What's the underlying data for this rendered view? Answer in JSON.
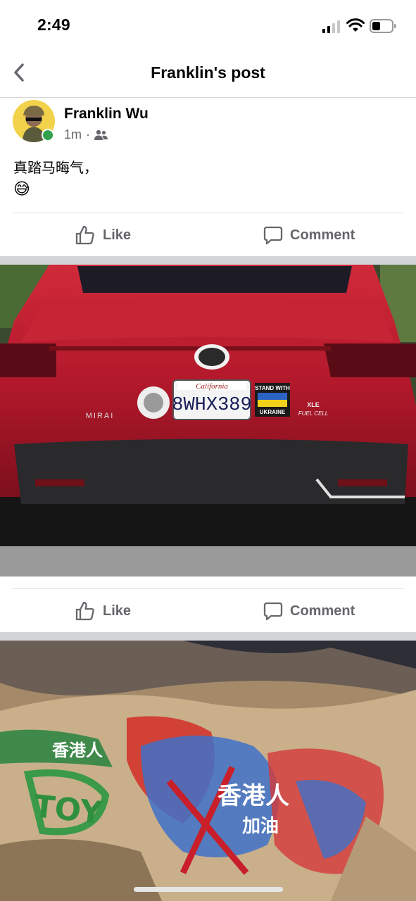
{
  "status_bar": {
    "time": "2:49",
    "signal_icon": "signal-bars-icon",
    "wifi_icon": "wifi-icon",
    "battery_icon": "battery-icon"
  },
  "nav": {
    "back_icon": "chevron-left-icon",
    "title": "Franklin's post"
  },
  "post": {
    "author": "Franklin Wu",
    "time": "1m",
    "separator": "·",
    "audience_icon": "friends-icon",
    "online": true,
    "text": "真踏马晦气，",
    "emoji": "😅",
    "actions": {
      "like": "Like",
      "comment": "Comment"
    }
  },
  "photos": [
    {
      "subject": "car",
      "plate_state": "California",
      "plate_number": "8WHX389",
      "sticker_line1": "STAND WITH",
      "sticker_line2": "UKRAINE",
      "model_badge": "MIRAI",
      "trim_badge1": "XLE",
      "trim_badge2": "FUEL CELL",
      "actions": {
        "like": "Like",
        "comment": "Comment"
      }
    },
    {
      "subject": "graffiti-rock",
      "graffiti_text1": "香港人",
      "graffiti_text2": "加油",
      "graffiti_text3": "TOY",
      "graffiti_text4": "香港人"
    }
  ],
  "colors": {
    "accent_online": "#31a24c",
    "text_secondary": "#65676b",
    "car_red": "#b3192b"
  }
}
